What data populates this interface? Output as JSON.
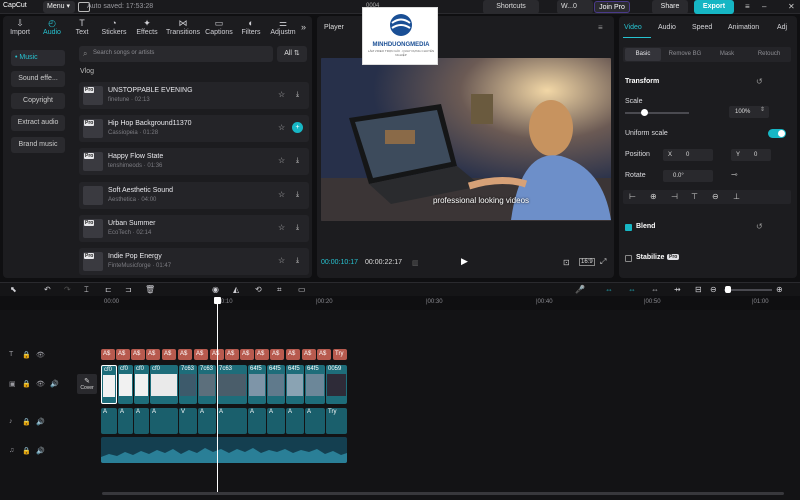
{
  "titlebar": {
    "app_name": "CapCut",
    "menu_label": "Menu",
    "autosave": "Auto saved: 17:53:28",
    "shortcuts": "Shortcuts",
    "workspace": "W...0",
    "join_pro": "Join Pro",
    "share": "Share",
    "export": "Export",
    "center_text": "0004"
  },
  "tabs": [
    {
      "label": "Import",
      "icon": "import-icon"
    },
    {
      "label": "Audio",
      "icon": "audio-icon",
      "active": true
    },
    {
      "label": "Text",
      "icon": "text-icon"
    },
    {
      "label": "Stickers",
      "icon": "stickers-icon"
    },
    {
      "label": "Effects",
      "icon": "effects-icon"
    },
    {
      "label": "Transitions",
      "icon": "transitions-icon"
    },
    {
      "label": "Captions",
      "icon": "captions-icon"
    },
    {
      "label": "Filters",
      "icon": "filters-icon"
    },
    {
      "label": "Adjustm",
      "icon": "adjust-icon"
    }
  ],
  "sidenav": [
    "• Music",
    "Sound effe...",
    "Copyright",
    "Extract audio",
    "Brand music"
  ],
  "search": {
    "placeholder": "Search songs or artists",
    "all_label": "All"
  },
  "section": "Vlog",
  "songs": [
    {
      "title": "UNSTOPPABLE EVENING",
      "sub": "finetune · 02:13"
    },
    {
      "title": "Hip Hop Background11370",
      "sub": "Cassiopeia · 01:28"
    },
    {
      "title": "Happy Flow State",
      "sub": "tenshimeods · 01:36"
    },
    {
      "title": "Soft Aesthetic Sound",
      "sub": "Aesthetica · 04:00"
    },
    {
      "title": "Urban Summer",
      "sub": "EcoTech · 02:14"
    },
    {
      "title": "Indie Pop Energy",
      "sub": "FinteMusicforge · 01:47"
    }
  ],
  "player": {
    "title": "Player",
    "subtitle": "professional looking videos",
    "time_current": "00:00:10:17",
    "time_total": "00:00:22:17",
    "ratio": "16:9"
  },
  "watermark": {
    "title": "MINHDUONGMEDIA",
    "sub": "LÀM VIDEO TRỌN GÓI · QUAY DỰNG CHUYÊN NGHIỆP"
  },
  "right": {
    "tabs": [
      "Video",
      "Audio",
      "Speed",
      "Animation",
      "Adj"
    ],
    "subtabs": [
      "Basic",
      "Remove BG",
      "Mask",
      "Retouch"
    ],
    "transform": "Transform",
    "scale_label": "Scale",
    "scale_value": "100%",
    "uniform_scale": "Uniform scale",
    "position_label": "Position",
    "pos_x_label": "X",
    "pos_x": "0",
    "pos_y_label": "Y",
    "pos_y": "0",
    "rotate_label": "Rotate",
    "rotate_value": "0.0°",
    "blend": "Blend",
    "stabilize": "Stabilize",
    "pro_badge": "Pro"
  },
  "ruler": [
    "00:00",
    "|00:10",
    "|00:20",
    "|00:30",
    "|00:40",
    "|00:50",
    "|01:00"
  ],
  "text_clips": [
    "A$",
    "A$",
    "A$",
    "A$",
    "A$",
    "A$",
    "A$",
    "A$",
    "A$",
    "A$",
    "A$",
    "A$",
    "A$",
    "A$",
    "A$",
    "A$",
    "A$",
    "A$",
    "Try"
  ],
  "video_clips": [
    "cf0",
    "cf0",
    "cf0",
    "cf0",
    "7c63",
    "7c63",
    "7c63",
    "64f5",
    "64f5",
    "64f5",
    "64f5",
    "0059"
  ],
  "audio_clips": [
    "A",
    "A",
    "A",
    "A",
    "V",
    "A",
    "A",
    "A",
    "A",
    "A",
    "A",
    "A",
    "A",
    "Try"
  ],
  "cover_label": "Cover",
  "colors": {
    "accent": "#27c3d1",
    "text_clip": "#b75a4e",
    "video_clip": "#1e6d7a",
    "export": "#16b6c4"
  }
}
